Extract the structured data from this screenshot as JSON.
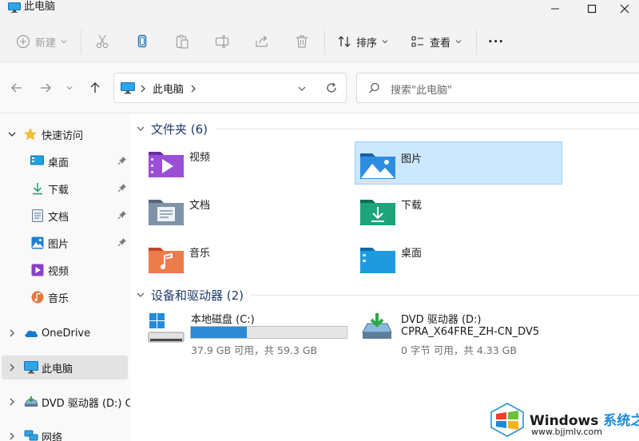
{
  "window": {
    "title": "此电脑"
  },
  "toolbar": {
    "new_label": "新建",
    "sort_label": "排序",
    "view_label": "查看",
    "more_label": "···"
  },
  "address": {
    "current": "此电脑"
  },
  "search": {
    "placeholder": "搜索\"此电脑\""
  },
  "sidebar": {
    "quick_access": "快速访问",
    "items": [
      {
        "label": "桌面",
        "pinned": true
      },
      {
        "label": "下载",
        "pinned": true
      },
      {
        "label": "文档",
        "pinned": true
      },
      {
        "label": "图片",
        "pinned": true
      },
      {
        "label": "视频",
        "pinned": false
      },
      {
        "label": "音乐",
        "pinned": false
      }
    ],
    "onedrive": "OneDrive",
    "this_pc": "此电脑",
    "dvd": "DVD 驱动器 (D:) CF",
    "network": "网络"
  },
  "folders": {
    "heading": "文件夹 (6)",
    "items": [
      {
        "label": "视频",
        "icon": "videos-folder-icon"
      },
      {
        "label": "图片",
        "icon": "pictures-folder-icon",
        "selected": true
      },
      {
        "label": "文档",
        "icon": "documents-folder-icon"
      },
      {
        "label": "下载",
        "icon": "downloads-folder-icon"
      },
      {
        "label": "音乐",
        "icon": "music-folder-icon"
      },
      {
        "label": "桌面",
        "icon": "desktop-folder-icon"
      }
    ]
  },
  "drives": {
    "heading": "设备和驱动器 (2)",
    "items": [
      {
        "name": "本地磁盘 (C:)",
        "detail": "37.9 GB 可用，共 59.3 GB",
        "used_fraction": 0.36
      },
      {
        "name": "DVD 驱动器 (D:)",
        "volume": "CPRA_X64FRE_ZH-CN_DV5",
        "detail": "0 字节 可用，共 4.33 GB"
      }
    ]
  },
  "watermark": {
    "brand": "Windows",
    "brand_cn": "系统之家",
    "url": "www.bjjmlv.com"
  },
  "colors": {
    "accent": "#0078d4",
    "selection": "#cce8ff",
    "bar_fill": "#2a8ad4",
    "heading": "#1f3b6b"
  }
}
